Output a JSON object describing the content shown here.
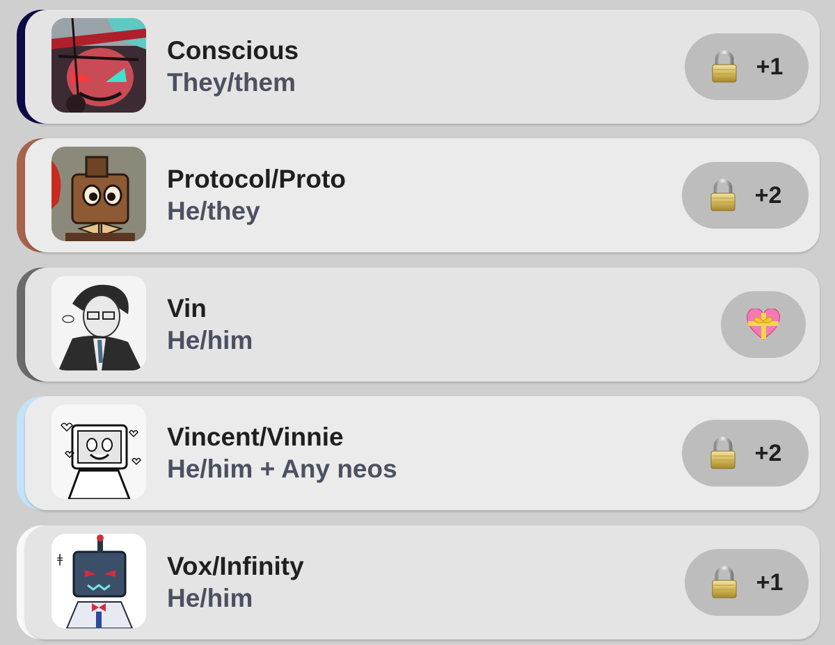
{
  "colors": {
    "background": "#cfcfcf",
    "card": "#e4e4e4",
    "pill": "#bdbdbd",
    "name_text": "#1f1f1f",
    "pronoun_text": "#4b5160"
  },
  "members": [
    {
      "name": "Conscious",
      "pronouns": "They/them",
      "accent": "#0d0b47",
      "badge": "lock-icon",
      "count": "+1"
    },
    {
      "name": "Protocol/Proto",
      "pronouns": "He/they",
      "accent": "#a8634c",
      "badge": "lock-icon",
      "count": "+2"
    },
    {
      "name": "Vin",
      "pronouns": "He/him",
      "accent": "#6b6b6b",
      "badge": "gift-heart-icon",
      "count": ""
    },
    {
      "name": "Vincent/Vinnie",
      "pronouns": "He/him + Any neos",
      "accent": "#c3e3f7",
      "badge": "lock-icon",
      "count": "+2"
    },
    {
      "name": "Vox/Infinity",
      "pronouns": "He/him",
      "accent": "#f8f8f8",
      "badge": "lock-icon",
      "count": "+1"
    }
  ]
}
